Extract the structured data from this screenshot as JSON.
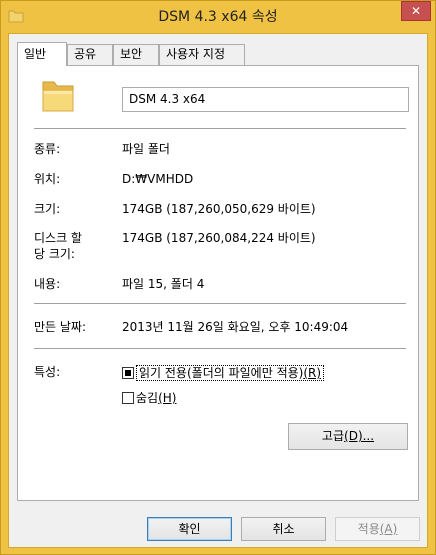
{
  "window": {
    "title": "DSM 4.3 x64 속성",
    "close_label": "✕",
    "title_icon": "folder-icon"
  },
  "tabs": [
    {
      "label": "일반",
      "active": true
    },
    {
      "label": "공유",
      "active": false
    },
    {
      "label": "보안",
      "active": false
    },
    {
      "label": "사용자 지정",
      "active": false
    }
  ],
  "general": {
    "folder_name": "DSM 4.3 x64",
    "type_label": "종류:",
    "type_value": "파일 폴더",
    "location_label": "위치:",
    "location_value": "D:₩VMHDD",
    "size_label": "크기:",
    "size_value": "174GB (187,260,050,629 바이트)",
    "disk_size_label_line1": "디스크 할",
    "disk_size_label_line2": "당 크기:",
    "disk_size_value": "174GB (187,260,084,224 바이트)",
    "contents_label": "내용:",
    "contents_value": "파일 15, 폴더 4",
    "created_label": "만든 날짜:",
    "created_value": "2013년 11월 26일 화요일, 오후 10:49:04",
    "attributes_label": "특성:",
    "readonly_label": "읽기 전용(폴더의 파일에만 적용)",
    "readonly_mnemonic": "(R)",
    "readonly_state": "indeterminate",
    "hidden_label": "숨김",
    "hidden_mnemonic": "(H)",
    "hidden_checked": false,
    "advanced_label": "고급",
    "advanced_mnemonic": "(D)...",
    "ok_label": "확인",
    "cancel_label": "취소",
    "apply_label": "적용",
    "apply_mnemonic": "(A)"
  },
  "colors": {
    "frame": "#f0c243",
    "close": "#c75050",
    "folder": "#f3d36b"
  }
}
